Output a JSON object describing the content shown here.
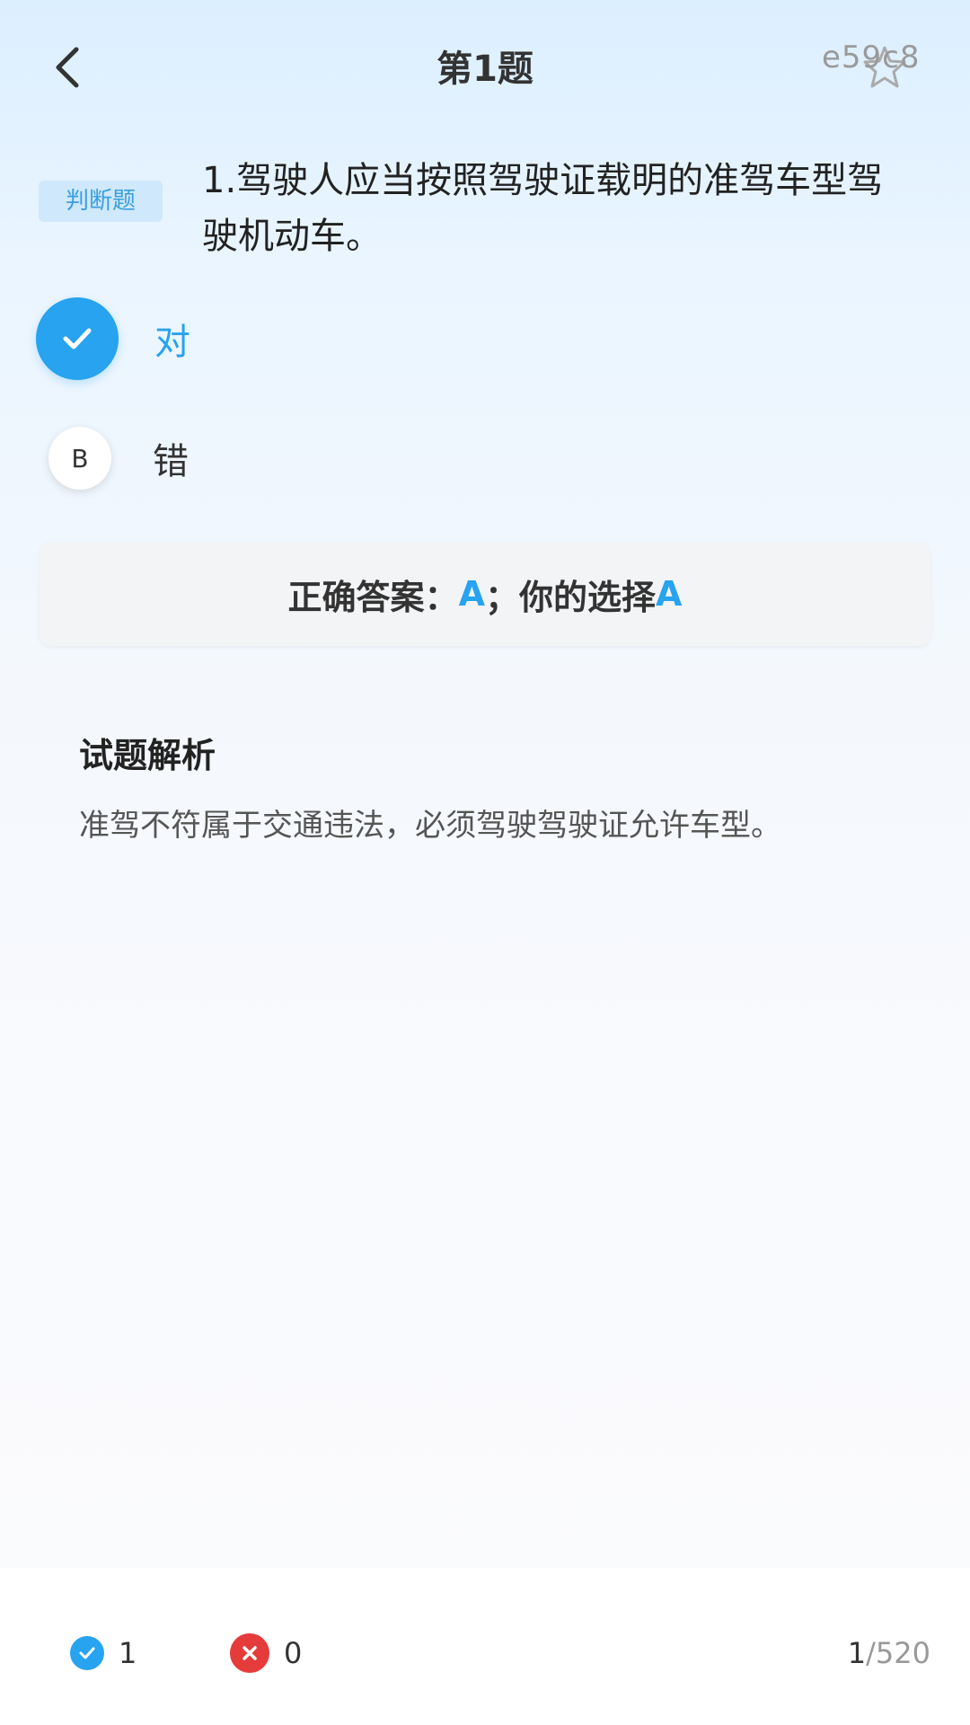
{
  "header": {
    "title": "第1题",
    "watermark": "e59c8",
    "back_icon": "chevron-left-icon",
    "favorite_icon": "star-outline-icon"
  },
  "question": {
    "type_tag": "判断题",
    "text": "1.驾驶人应当按照驾驶证载明的准驾车型驾驶机动车。"
  },
  "options": [
    {
      "selected_icon": "check-icon",
      "label": "对",
      "selected": true
    },
    {
      "letter": "B",
      "label": "错",
      "selected": false
    }
  ],
  "answer": {
    "correct_label": "正确答案：",
    "correct_value": "A",
    "separator": "；",
    "your_label": "你的选择",
    "your_value": "A"
  },
  "analysis": {
    "title": "试题解析",
    "text": "准驾不符属于交通违法，必须驾驶驾驶证允许车型。"
  },
  "footer": {
    "correct_count": "1",
    "wrong_count": "0",
    "progress_current": "1",
    "progress_total": "/520"
  },
  "colors": {
    "accent": "#27a3ef",
    "wrong": "#e53b3b",
    "tag_bg": "#cfe8fb"
  }
}
